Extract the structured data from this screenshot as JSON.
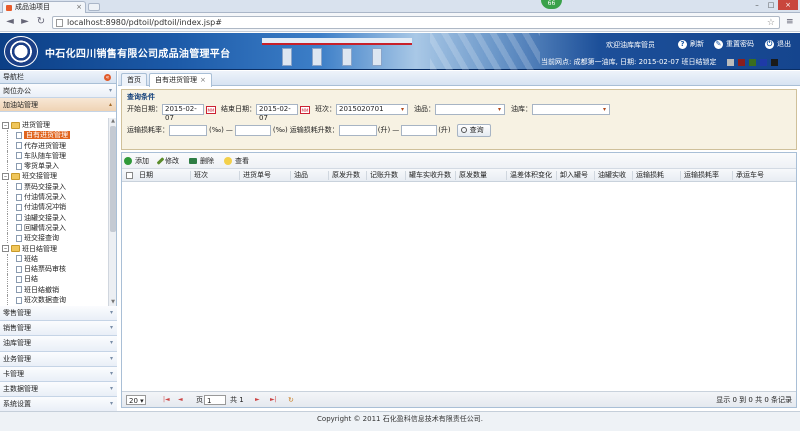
{
  "browser": {
    "tab_title": "成品油项目",
    "tab_close": "×",
    "url": "localhost:8980/pdtoil/pdtoil/index.jsp#",
    "badge": "66",
    "win_min": "–",
    "win_max": "□",
    "win_close": "×",
    "back": "◄",
    "forward": "►",
    "reload": "↻",
    "star": "☆",
    "menu": "≡"
  },
  "header": {
    "title": "中石化四川销售有限公司成品油管理平台",
    "welcome": "欢迎油库库管员",
    "refresh": "刷新",
    "reset_password": "重置密码",
    "logout": "退出",
    "station_info": "当前网点: 成都第一油库, 日期: 2015-02-07 班日结锁定",
    "swatch_colors": [
      "#bcbcbc",
      "#8a1e1e",
      "#3a6e1e",
      "#1e3aa8",
      "#1a1a1a"
    ]
  },
  "sidebar": {
    "title": "导航栏",
    "collapse_icon": "«",
    "sections": [
      {
        "label": "岗位办公",
        "chev": "▾"
      },
      {
        "label": "加油站管理",
        "chev": "▴"
      }
    ],
    "tree": [
      {
        "label": "进货管理",
        "type": "folder",
        "level": 0
      },
      {
        "label": "自有进货管理",
        "type": "doc",
        "level": 1,
        "selected": true
      },
      {
        "label": "代存进货管理",
        "type": "doc",
        "level": 1
      },
      {
        "label": "车队随车管理",
        "type": "doc",
        "level": 1
      },
      {
        "label": "零货单录入",
        "type": "doc",
        "level": 1
      },
      {
        "label": "班交接管理",
        "type": "folder",
        "level": 0
      },
      {
        "label": "票码交接录入",
        "type": "doc",
        "level": 1
      },
      {
        "label": "付油情况录入",
        "type": "doc",
        "level": 1
      },
      {
        "label": "付油情况冲销",
        "type": "doc",
        "level": 1
      },
      {
        "label": "油罐交接录入",
        "type": "doc",
        "level": 1
      },
      {
        "label": "回罐情况录入",
        "type": "doc",
        "level": 1
      },
      {
        "label": "班交接查询",
        "type": "doc",
        "level": 1
      },
      {
        "label": "班日结管理",
        "type": "folder",
        "level": 0
      },
      {
        "label": "班结",
        "type": "doc",
        "level": 1
      },
      {
        "label": "日结票码审核",
        "type": "doc",
        "level": 1
      },
      {
        "label": "日结",
        "type": "doc",
        "level": 1
      },
      {
        "label": "班日结撤销",
        "type": "doc",
        "level": 1
      },
      {
        "label": "班次数据查询",
        "type": "doc",
        "level": 1
      }
    ],
    "bottom_sections": [
      {
        "label": "零售管理",
        "chev": "▾"
      },
      {
        "label": "销售管理",
        "chev": "▾"
      },
      {
        "label": "油库管理",
        "chev": "▾"
      },
      {
        "label": "业务管理",
        "chev": "▾"
      },
      {
        "label": "卡管理",
        "chev": "▾"
      },
      {
        "label": "主数据管理",
        "chev": "▾"
      },
      {
        "label": "系统设置",
        "chev": "▾"
      }
    ]
  },
  "tabs": [
    {
      "label": "首页",
      "active": false
    },
    {
      "label": "自有进货管理",
      "active": true,
      "close": "×"
    }
  ],
  "query": {
    "title": "查询条件",
    "start_date_label": "开始日期：",
    "start_date": "2015-02-07",
    "end_date_label": "结束日期：",
    "end_date": "2015-02-07",
    "shift_label": "班次：",
    "shift": "2015020701",
    "product_label": "油品：",
    "product": "",
    "depot_label": "油库：",
    "depot": "",
    "loss_rate_label": "运输损耗率：",
    "loss_rate_unit": "(‰)",
    "dash": "—",
    "loss_qty_label": "运输损耗升数：",
    "loss_qty_unit": "(升)",
    "search_button": "查询",
    "calendar": "MM"
  },
  "toolbar": {
    "add": "添加",
    "edit": "修改",
    "delete": "删除",
    "view": "查看"
  },
  "table": {
    "columns": [
      "日期",
      "班次",
      "进货单号",
      "油品",
      "原发升数",
      "记账升数",
      "罐车实收升数",
      "原发数量",
      "温差体积变化",
      "卸入罐号",
      "油罐实收",
      "运输损耗",
      "运输损耗率",
      "承运车号"
    ]
  },
  "pager": {
    "page_size": "20",
    "page_label": "页",
    "page": "1",
    "total_label": "共 1",
    "first": "|◄",
    "prev": "◄",
    "next": "►",
    "last": "►|",
    "refresh": "↻",
    "summary": "显示 0 到 0 共 0 条记录"
  },
  "footer": {
    "copyright": "Copyright © 2011 石化盈科信息技术有限责任公司."
  }
}
